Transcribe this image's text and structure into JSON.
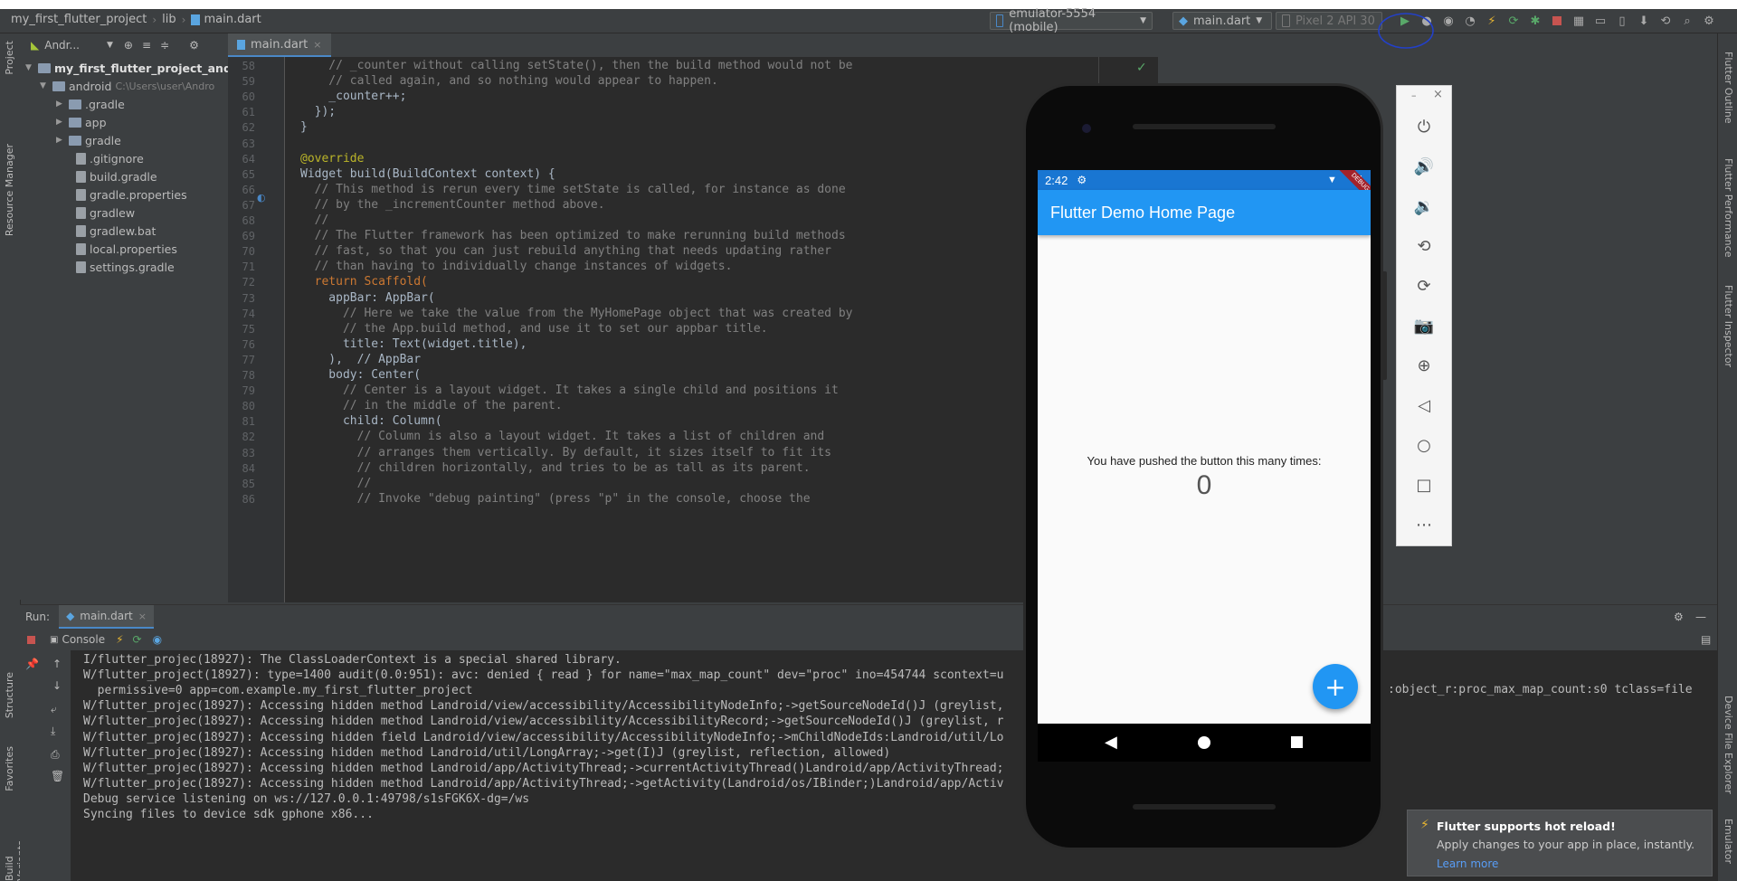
{
  "breadcrumb": {
    "project": "my_first_flutter_project",
    "folder": "lib",
    "file": "main.dart"
  },
  "toolbar": {
    "device": "emulator-5554 (mobile)",
    "config": "main.dart",
    "avd": "Pixel 2 API 30"
  },
  "left_stripe": {
    "project": "Project",
    "resource_manager": "Resource Manager",
    "structure": "Structure",
    "favorites": "Favorites",
    "build_variants": "Build Variants"
  },
  "right_stripe": {
    "outline": "Flutter Outline",
    "performance": "Flutter Performance",
    "inspector": "Flutter Inspector",
    "device_file": "Device File Explorer",
    "emulator": "Emulator"
  },
  "project_panel": {
    "view": "Andr...",
    "root": "my_first_flutter_project_android",
    "module": "android",
    "module_path": "C:\\Users\\user\\Andro",
    "items": [
      ".gradle",
      "app",
      "gradle",
      ".gitignore",
      "build.gradle",
      "gradle.properties",
      "gradlew",
      "gradlew.bat",
      "local.properties",
      "settings.gradle"
    ]
  },
  "editor": {
    "tab": "main.dart",
    "line_numbers": [
      "58",
      "59",
      "60",
      "61",
      "62",
      "63",
      "64",
      "65",
      "66",
      "67",
      "68",
      "69",
      "70",
      "71",
      "72",
      "73",
      "74",
      "75",
      "76",
      "77",
      "78",
      "79",
      "80",
      "81",
      "82",
      "83",
      "84",
      "85",
      "86"
    ],
    "lines": [
      "    // _counter without calling setState(), then the build method would not be",
      "    // called again, and so nothing would appear to happen.",
      "    _counter++;",
      "  });",
      "}",
      "",
      "@override",
      "Widget build(BuildContext context) {",
      "  // This method is rerun every time setState is called, for instance as done",
      "  // by the _incrementCounter method above.",
      "  //",
      "  // The Flutter framework has been optimized to make rerunning build methods",
      "  // fast, so that you can just rebuild anything that needs updating rather",
      "  // than having to individually change instances of widgets.",
      "  return Scaffold(",
      "    appBar: AppBar(",
      "      // Here we take the value from the MyHomePage object that was created by",
      "      // the App.build method, and use it to set our appbar title.",
      "      title: Text(widget.title),",
      "    ),  // AppBar",
      "    body: Center(",
      "      // Center is a layout widget. It takes a single child and positions it",
      "      // in the middle of the parent.",
      "      child: Column(",
      "        // Column is also a layout widget. It takes a list of children and",
      "        // arranges them vertically. By default, it sizes itself to fit its",
      "        // children horizontally, and tries to be as tall as its parent.",
      "        //",
      "        // Invoke \"debug painting\" (press \"p\" in the console, choose the"
    ]
  },
  "run_panel": {
    "label": "Run:",
    "tab": "main.dart",
    "console_tab": "Console",
    "lines": [
      "I/flutter_projec(18927): The ClassLoaderContext is a special shared library.",
      "W/flutter_project(18927): type=1400 audit(0.0:951): avc: denied { read } for name=\"max_map_count\" dev=\"proc\" ino=454744 scontext=u",
      "  permissive=0 app=com.example.my_first_flutter_project",
      "W/flutter_projec(18927): Accessing hidden method Landroid/view/accessibility/AccessibilityNodeInfo;->getSourceNodeId()J (greylist,",
      "W/flutter_projec(18927): Accessing hidden method Landroid/view/accessibility/AccessibilityRecord;->getSourceNodeId()J (greylist, r",
      "W/flutter_projec(18927): Accessing hidden field Landroid/view/accessibility/AccessibilityNodeInfo;->mChildNodeIds:Landroid/util/Lo",
      "W/flutter_projec(18927): Accessing hidden method Landroid/util/LongArray;->get(I)J (greylist, reflection, allowed)",
      "W/flutter_projec(18927): Accessing hidden method Landroid/app/ActivityThread;->currentActivityThread()Landroid/app/ActivityThread;",
      "W/flutter_projec(18927): Accessing hidden method Landroid/app/ActivityThread;->getActivity(Landroid/os/IBinder;)Landroid/app/Activ",
      "Debug service listening on ws://127.0.0.1:49798/s1sFGK6X-dg=/ws",
      "Syncing files to device sdk gphone x86..."
    ],
    "overflow_text": ":object_r:proc_max_map_count:s0 tclass=file"
  },
  "phone": {
    "time": "2:42",
    "debug_banner": "DEBUG",
    "app_title": "Flutter Demo Home Page",
    "message": "You have pushed the button this many times:",
    "counter": "0",
    "fab": "+"
  },
  "notification": {
    "title": "Flutter supports hot reload!",
    "body": "Apply changes to your app in place, instantly.",
    "link": "Learn more"
  },
  "colors": {
    "accent": "#2196f3",
    "run_green": "#59a869",
    "stop_red": "#c75450"
  }
}
